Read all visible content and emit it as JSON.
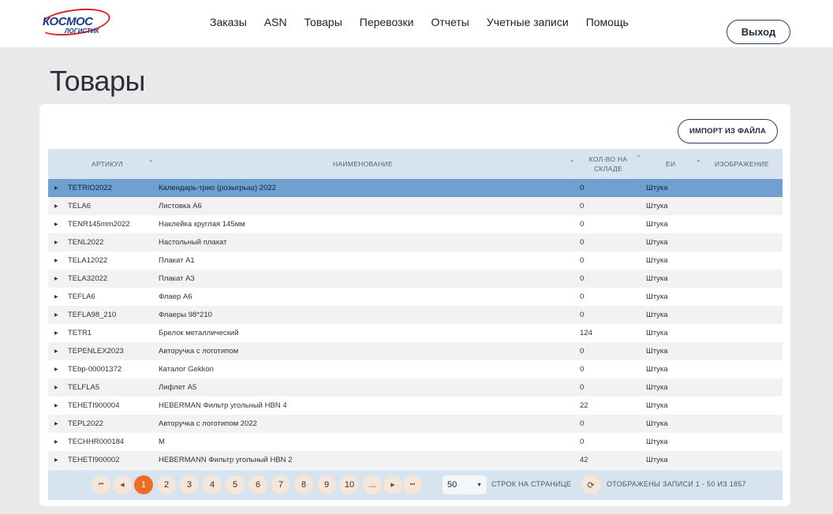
{
  "logo": {
    "line1": "КОСМОС",
    "line2": "ЛОГИСТИК"
  },
  "nav": [
    "Заказы",
    "ASN",
    "Товары",
    "Перевозки",
    "Отчеты",
    "Учетные записи",
    "Помощь"
  ],
  "logout_label": "Выход",
  "page_title": "Товары",
  "import_label": "ИМПОРТ ИЗ ФАЙЛА",
  "columns": {
    "sku": "АРТИКУЛ",
    "name": "НАИМЕНОВАНИЕ",
    "qty_line1": "КОЛ-ВО НА",
    "qty_line2": "СКЛАДЕ",
    "unit": "ЕИ",
    "image": "ИЗОБРАЖЕНИЕ"
  },
  "rows": [
    {
      "sku": "TETRIO2022",
      "name": "Календарь-трио (розыгрыш) 2022",
      "qty": "0",
      "unit": "Штука",
      "selected": true
    },
    {
      "sku": "TELA6",
      "name": "Листовка А6",
      "qty": "0",
      "unit": "Штука"
    },
    {
      "sku": "TENR145mm2022",
      "name": "Наклейка круглая 145мм",
      "qty": "0",
      "unit": "Штука"
    },
    {
      "sku": "TENL2022",
      "name": "Настольный плакат",
      "qty": "0",
      "unit": "Штука"
    },
    {
      "sku": "TELA12022",
      "name": "Плакат А1",
      "qty": "0",
      "unit": "Штука"
    },
    {
      "sku": "TELA32022",
      "name": "Плакат А3",
      "qty": "0",
      "unit": "Штука"
    },
    {
      "sku": "TEFLA6",
      "name": "Флаер А6",
      "qty": "0",
      "unit": "Штука"
    },
    {
      "sku": "TEFLA98_210",
      "name": "Флаеры 98*210",
      "qty": "0",
      "unit": "Штука"
    },
    {
      "sku": "TETR1",
      "name": "Брелок металлический",
      "qty": "124",
      "unit": "Штука"
    },
    {
      "sku": "TEPENLEX2023",
      "name": "Авторучка с логотипом",
      "qty": "0",
      "unit": "Штука"
    },
    {
      "sku": "TEbp-00001372",
      "name": "Каталог Gekkon",
      "qty": "0",
      "unit": "Штука"
    },
    {
      "sku": "TELFLA5",
      "name": "Лифлет А5",
      "qty": "0",
      "unit": "Штука"
    },
    {
      "sku": "TEHETI900004",
      "name": "HEBERMAN Фильтр угольный HBN 4",
      "qty": "22",
      "unit": "Штука"
    },
    {
      "sku": "TEPL2022",
      "name": "Авторучка с логотипом 2022",
      "qty": "0",
      "unit": "Штука"
    },
    {
      "sku": "TECHHR000184",
      "name": "M",
      "qty": "0",
      "unit": "Штука"
    },
    {
      "sku": "TEHETI900002",
      "name": "HEBERMANN Фильтр угольный HBN 2",
      "qty": "42",
      "unit": "Штука"
    }
  ],
  "pager": {
    "pages": [
      "1",
      "2",
      "3",
      "4",
      "5",
      "6",
      "7",
      "8",
      "9",
      "10",
      "..."
    ],
    "current": "1",
    "page_size": "50",
    "per_page_label": "СТРОК НА СТРАНИЦЕ",
    "records_label": "ОТОБРАЖЕНЫ ЗАПИСИ 1 - 50 ИЗ 1857"
  },
  "icons": {
    "expand": "expand-arrow-icon",
    "sort": "chevron-down-icon",
    "first": "first-page-icon",
    "prev": "prev-page-icon",
    "next": "next-page-icon",
    "last": "last-page-icon",
    "refresh": "refresh-icon"
  },
  "colors": {
    "accent": "#ee6c24",
    "header_bg": "#d7e3ef",
    "selected_row": "#6fa0cf"
  }
}
